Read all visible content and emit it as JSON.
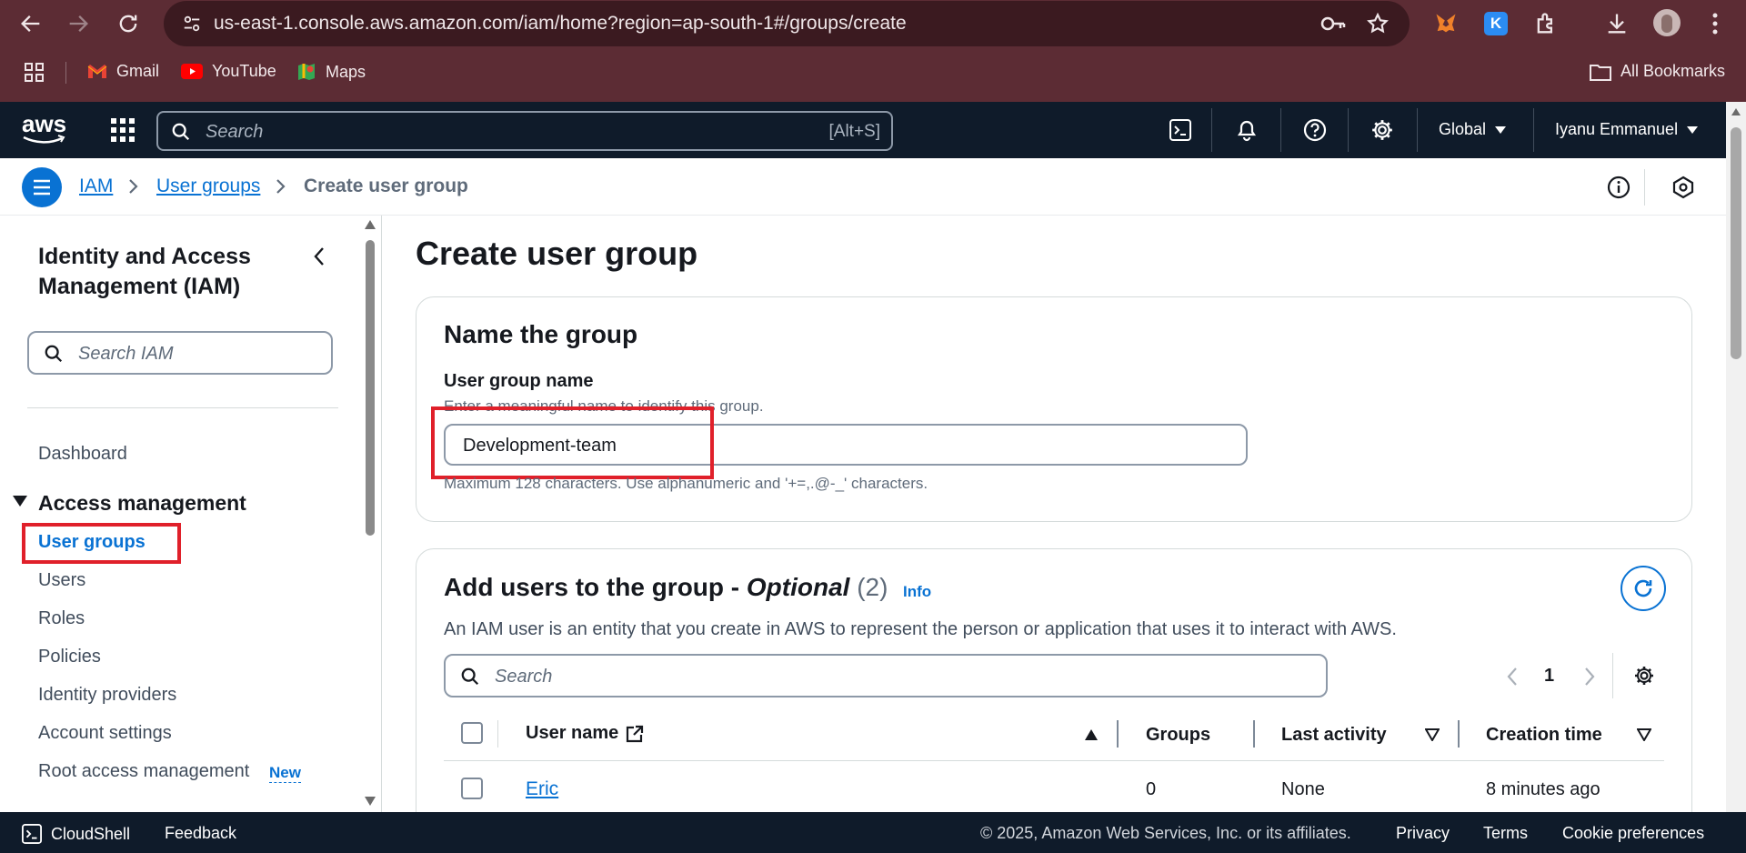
{
  "browser": {
    "url": "us-east-1.console.aws.amazon.com/iam/home?region=ap-south-1#/groups/create",
    "bookmarks": [
      {
        "label": "Gmail",
        "icon": "gmail-icon"
      },
      {
        "label": "YouTube",
        "icon": "youtube-icon"
      },
      {
        "label": "Maps",
        "icon": "maps-icon"
      }
    ],
    "all_bookmarks": "All Bookmarks"
  },
  "aws_header": {
    "logo": "aws",
    "search_placeholder": "Search",
    "search_shortcut": "[Alt+S]",
    "region": "Global",
    "user": "Iyanu Emmanuel"
  },
  "breadcrumb": {
    "items": [
      "IAM",
      "User groups"
    ],
    "current": "Create user group"
  },
  "sidebar": {
    "title": "Identity and Access Management (IAM)",
    "search_placeholder": "Search IAM",
    "dashboard": "Dashboard",
    "section": "Access management",
    "items": [
      {
        "label": "User groups",
        "active": true
      },
      {
        "label": "Users"
      },
      {
        "label": "Roles"
      },
      {
        "label": "Policies"
      },
      {
        "label": "Identity providers"
      },
      {
        "label": "Account settings"
      },
      {
        "label": "Root access management",
        "badge": "New"
      }
    ]
  },
  "main": {
    "title": "Create user group",
    "name_card": {
      "heading": "Name the group",
      "field_label": "User group name",
      "field_hint": "Enter a meaningful name to identify this group.",
      "field_value": "Development-team",
      "constraint": "Maximum 128 characters. Use alphanumeric and '+=,.@-_' characters."
    },
    "users_card": {
      "heading": "Add users to the group - ",
      "heading_optional": "Optional",
      "count": "(2)",
      "info": "Info",
      "description": "An IAM user is an entity that you create in AWS to represent the person or application that uses it to interact with AWS.",
      "search_placeholder": "Search",
      "page": "1",
      "columns": [
        "User name",
        "Groups",
        "Last activity",
        "Creation time"
      ],
      "rows": [
        {
          "user": "Eric",
          "groups": "0",
          "last_activity": "None",
          "created": "8 minutes ago"
        }
      ]
    }
  },
  "footer": {
    "cloudshell": "CloudShell",
    "feedback": "Feedback",
    "copyright": "© 2025, Amazon Web Services, Inc. or its affiliates.",
    "privacy": "Privacy",
    "terms": "Terms",
    "cookies": "Cookie preferences"
  },
  "colors": {
    "browser_frame": "#5c2c34",
    "aws_header": "#0f1b2a",
    "link": "#0972d3",
    "highlight": "#e0202a"
  }
}
